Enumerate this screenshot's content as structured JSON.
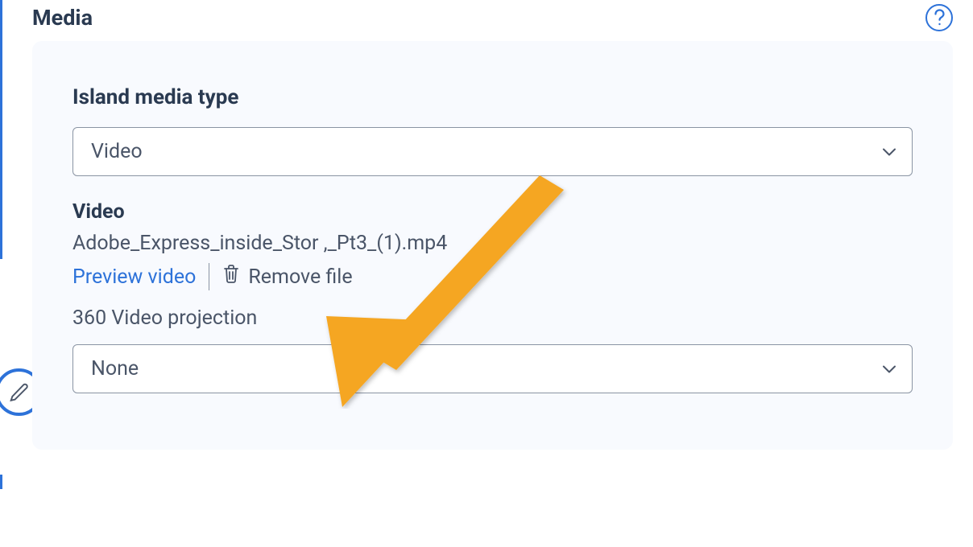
{
  "section": {
    "title": "Media"
  },
  "mediaType": {
    "label": "Island media type",
    "selected": "Video"
  },
  "video": {
    "label": "Video",
    "filename": "Adobe_Express_inside_Stor      ,_Pt3_(1).mp4",
    "preview_label": "Preview video",
    "remove_label": "Remove file"
  },
  "projection": {
    "label": "360 Video projection",
    "selected": "None"
  }
}
